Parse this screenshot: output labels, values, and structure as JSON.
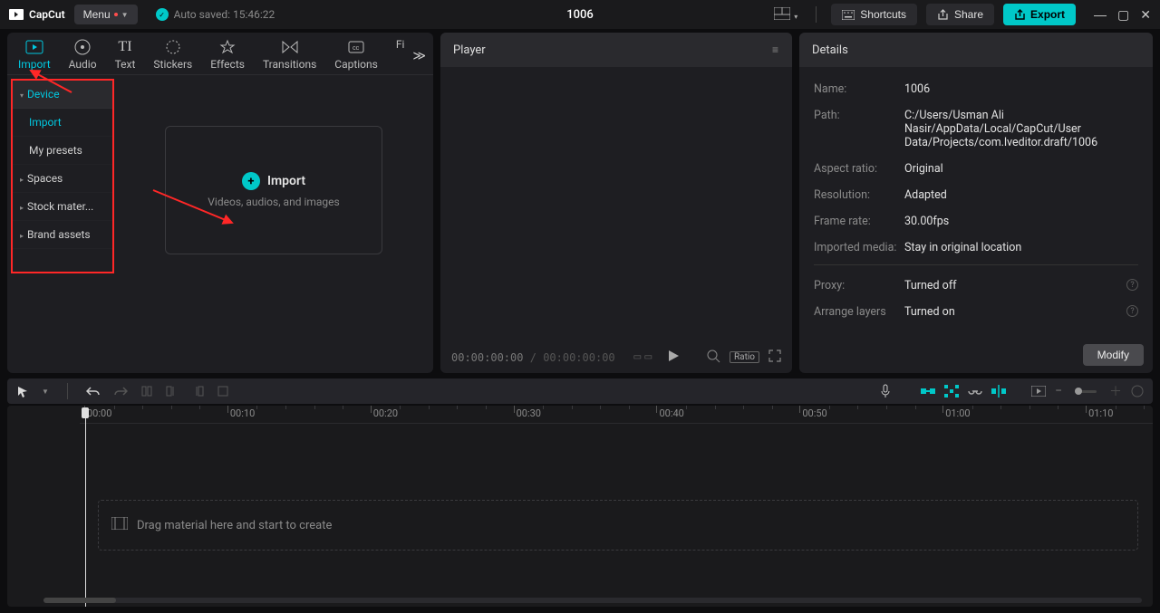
{
  "app": {
    "name": "CapCut"
  },
  "menu": {
    "label": "Menu"
  },
  "auto_saved": {
    "label": "Auto saved:",
    "time": "15:46:22"
  },
  "project_title": "1006",
  "shortcuts_label": "Shortcuts",
  "share_label": "Share",
  "export_label": "Export",
  "tabs": {
    "import": "Import",
    "audio": "Audio",
    "text": "Text",
    "stickers": "Stickers",
    "effects": "Effects",
    "transitions": "Transitions",
    "captions": "Captions",
    "filters": "Fi"
  },
  "tree": {
    "device": "Device",
    "import": "Import",
    "presets": "My presets",
    "spaces": "Spaces",
    "stock": "Stock mater...",
    "brand": "Brand assets"
  },
  "drop": {
    "title": "Import",
    "sub": "Videos, audios, and images"
  },
  "player": {
    "title": "Player",
    "time_current": "00:00:00:00",
    "time_total": "00:00:00:00",
    "ratio": "Ratio"
  },
  "details": {
    "title": "Details",
    "labels": {
      "name": "Name:",
      "path": "Path:",
      "aspect": "Aspect ratio:",
      "resolution": "Resolution:",
      "framerate": "Frame rate:",
      "imported": "Imported media:",
      "proxy": "Proxy:",
      "arrange": "Arrange layers"
    },
    "values": {
      "name": "1006",
      "path": "C:/Users/Usman Ali Nasir/AppData/Local/CapCut/User Data/Projects/com.lveditor.draft/1006",
      "aspect": "Original",
      "resolution": "Adapted",
      "framerate": "30.00fps",
      "imported": "Stay in original location",
      "proxy": "Turned off",
      "arrange": "Turned on"
    },
    "modify": "Modify"
  },
  "timeline": {
    "drop_hint": "Drag material here and start to create",
    "marks": [
      "00:00",
      "00:10",
      "00:20",
      "00:30",
      "00:40",
      "00:50",
      "01:00",
      "01:10"
    ]
  }
}
